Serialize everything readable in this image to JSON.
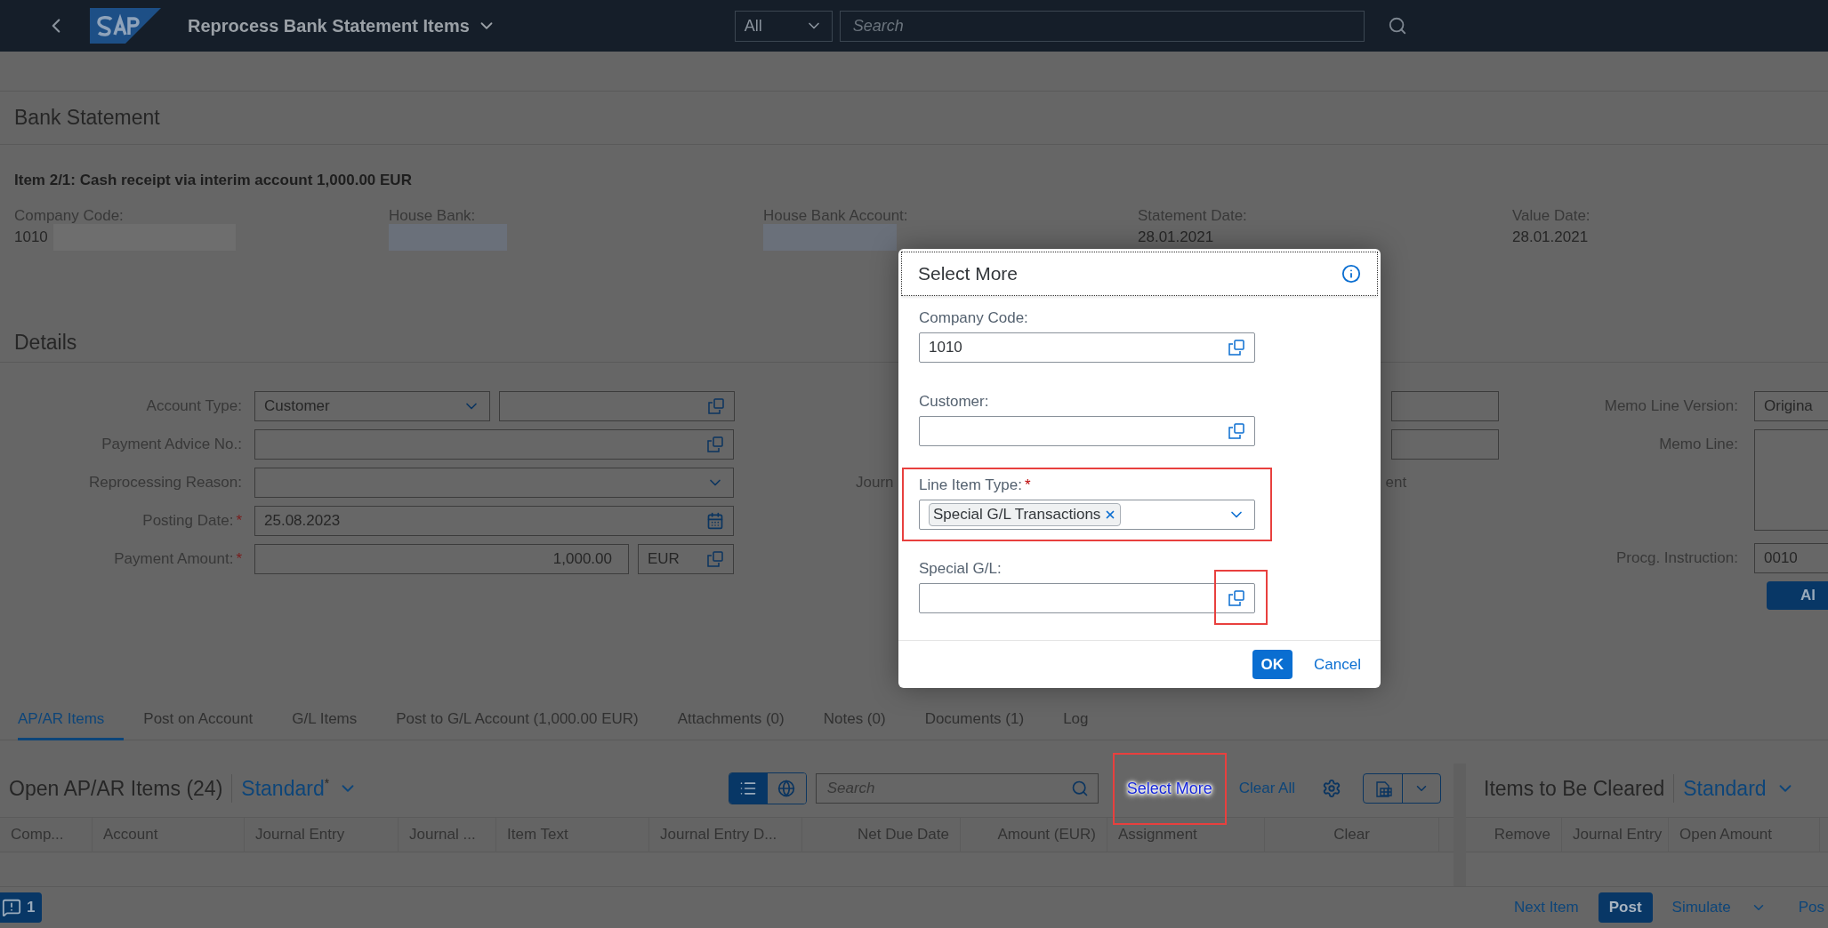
{
  "shell": {
    "title": "Reprocess Bank Statement Items",
    "scope": "All",
    "search_placeholder": "Search"
  },
  "bank_statement": {
    "heading": "Bank Statement",
    "item_title": "Item 2/1: Cash receipt via interim account 1,000.00 EUR",
    "fields": [
      {
        "label": "Company Code:",
        "value": "1010",
        "redacted": true
      },
      {
        "label": "House Bank:",
        "redacted": true
      },
      {
        "label": "House Bank Account:",
        "redacted": true
      },
      {
        "label": "Statement Date:",
        "value": "28.01.2021"
      },
      {
        "label": "Value Date:",
        "value": "28.01.2021"
      }
    ]
  },
  "details": {
    "heading": "Details",
    "left": [
      {
        "label": "Account Type:",
        "kind": "select-pair",
        "value": "Customer",
        "required": false
      },
      {
        "label": "Payment Advice No.:",
        "kind": "valuehelp",
        "required": false
      },
      {
        "label": "Reprocessing Reason:",
        "kind": "select",
        "required": false
      },
      {
        "label": "Posting Date:",
        "kind": "date",
        "value": "25.08.2023",
        "required": true
      },
      {
        "label": "Payment Amount:",
        "kind": "amount",
        "value": "1,000.00",
        "currency": "EUR",
        "required": true
      }
    ],
    "middle": {
      "label_fragment": "Journ",
      "text_fragment": "ent"
    },
    "right": [
      {
        "label": "Memo Line Version:",
        "kind": "input",
        "value": "Origina"
      },
      {
        "label": "Memo Line:",
        "kind": "textarea"
      },
      {
        "label": "Procg. Instruction:",
        "kind": "input",
        "value": "0010"
      }
    ],
    "button": "Al"
  },
  "tabs": [
    {
      "label": "AP/AR Items",
      "selected": true
    },
    {
      "label": "Post on Account",
      "selected": false
    },
    {
      "label": "G/L Items",
      "selected": false
    },
    {
      "label": "Post to G/L Account (1,000.00 EUR)",
      "selected": false
    },
    {
      "label": "Attachments (0)",
      "selected": false
    },
    {
      "label": "Notes (0)",
      "selected": false
    },
    {
      "label": "Documents (1)",
      "selected": false
    },
    {
      "label": "Log",
      "selected": false
    }
  ],
  "table": {
    "title": "Open AP/AR Items (24)",
    "variant": "Standard",
    "variant_mark": "*",
    "views": [
      {
        "kind": "list",
        "selected": true
      },
      {
        "kind": "map",
        "selected": false
      }
    ],
    "search_placeholder": "Search",
    "select_more": {
      "label": "Select More",
      "highlighted": true
    },
    "clear_all": "Clear All",
    "columns": [
      "Comp...",
      "Account",
      "Journal Entry",
      "Journal ...",
      "Item Text",
      "Journal Entry D...",
      "Net Due Date",
      "Amount (EUR)",
      "Assignment",
      "Clear"
    ]
  },
  "cleared": {
    "title": "Items to Be Cleared",
    "variant": "Standard",
    "columns": [
      "Remove",
      "Journal Entry",
      "Open Amount"
    ]
  },
  "footer": {
    "messages": "1",
    "actions": [
      {
        "label": "Next Item",
        "kind": "link"
      },
      {
        "label": "Post",
        "kind": "primary"
      },
      {
        "label": "Simulate",
        "kind": "menu"
      },
      {
        "label": "Pos",
        "kind": "link"
      }
    ]
  },
  "dialog": {
    "title": "Select More",
    "fields": [
      {
        "label": "Company Code:",
        "kind": "valuehelp",
        "value": "1010",
        "required": false,
        "highlighted": false,
        "button_highlighted": false
      },
      {
        "label": "Customer:",
        "kind": "valuehelp",
        "required": false,
        "highlighted": false,
        "button_highlighted": false
      },
      {
        "label": "Line Item Type:",
        "kind": "tokens",
        "tokens": [
          "Special G/L Transactions"
        ],
        "required": true,
        "highlighted": true,
        "button_highlighted": false
      },
      {
        "label": "Special G/L:",
        "kind": "valuehelp",
        "required": false,
        "highlighted": false,
        "button_highlighted": true
      }
    ],
    "buttons": [
      {
        "label": "OK",
        "kind": "emphasized"
      },
      {
        "label": "Cancel",
        "kind": "transparent"
      }
    ]
  }
}
